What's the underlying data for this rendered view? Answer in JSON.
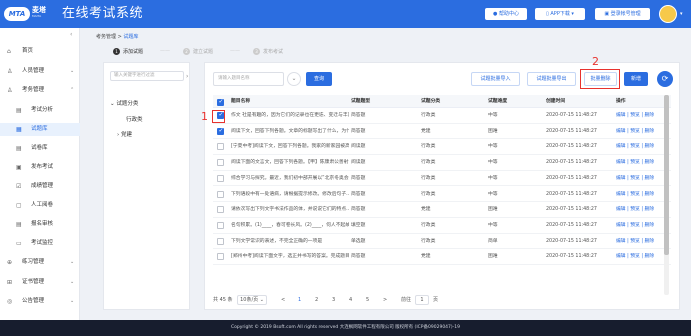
{
  "header": {
    "logo_text": "MTA",
    "brand_name": "麦塔",
    "brand_sub": "MAITA",
    "title": "在线考试系统",
    "help_label": "帮助中心",
    "app_label": "APP下载",
    "user_label": "登录帐号管理"
  },
  "sidebar": {
    "items": [
      {
        "icon": "home-icon",
        "label": "首页"
      },
      {
        "icon": "user-icon",
        "label": "人员管理"
      },
      {
        "icon": "person-icon",
        "label": "考务管理"
      },
      {
        "icon": "chart-icon",
        "label": "考试分析"
      },
      {
        "icon": "question-bank-icon",
        "label": "试题库"
      },
      {
        "icon": "exam-library-icon",
        "label": "试卷库"
      },
      {
        "icon": "publish-icon",
        "label": "发布考试"
      },
      {
        "icon": "score-icon",
        "label": "成绩管理"
      },
      {
        "icon": "grading-icon",
        "label": "人工阅卷"
      },
      {
        "icon": "review-icon",
        "label": "报名审核"
      },
      {
        "icon": "monitor-icon",
        "label": "考试监控"
      },
      {
        "icon": "practice-icon",
        "label": "练习管理"
      },
      {
        "icon": "certificate-icon",
        "label": "证书管理"
      },
      {
        "icon": "notice-icon",
        "label": "公告管理"
      }
    ]
  },
  "breadcrumb": {
    "parent": "考务管理",
    "sep": ">",
    "current": "试题库"
  },
  "steps": [
    {
      "num": "1",
      "label": "添加试题"
    },
    {
      "num": "2",
      "label": "建立试题"
    },
    {
      "num": "3",
      "label": "发布考试"
    }
  ],
  "tree": {
    "search_placeholder": "输入关键字进行过滤",
    "root": "试题分类",
    "child1": "行政类",
    "child2": "党建"
  },
  "toolbar": {
    "search_placeholder": "请输入题目名称",
    "search_btn": "查询",
    "import_btn": "试题批量导入",
    "export_btn": "试题批量导出",
    "delete_btn": "批量删除",
    "add_btn": "新增"
  },
  "table": {
    "headers": [
      "题目名称",
      "试题题型",
      "试题分类",
      "试题难度",
      "创建时间",
      "操作"
    ],
    "rows": [
      {
        "checked": true,
        "name": "作文 社是有趣的，因为它们的记录也在更迭、变迁与丰富...",
        "type": "简答题",
        "category": "行政类",
        "difficulty": "中等",
        "time": "2020-07-15 11:48:27",
        "ops": "编辑 | 预览 | 删除"
      },
      {
        "checked": true,
        "name": "阅读下文，回答下列各题。文章的标题写出了什么，为什么...",
        "type": "简答题",
        "category": "党建",
        "difficulty": "困难",
        "time": "2020-07-15 11:48:27",
        "ops": "编辑 | 预览 | 删除"
      },
      {
        "checked": false,
        "name": "[宁夏中考]阅读下文，回答下列各题。我家的新家园被高楼...",
        "type": "阅读题",
        "category": "行政类",
        "difficulty": "中等",
        "time": "2020-07-15 11:48:27",
        "ops": "编辑 | 预览 | 删除"
      },
      {
        "checked": false,
        "name": "阅读下面的文言文，回答下列各题。【甲】陈康肃公善射...",
        "type": "阅读题",
        "category": "行政类",
        "difficulty": "中等",
        "time": "2020-07-15 11:48:27",
        "ops": "编辑 | 预览 | 删除"
      },
      {
        "checked": false,
        "name": "综合学习与探究。最近，我们初中部开展以“北京冬奥会”...",
        "type": "简答题",
        "category": "行政类",
        "difficulty": "中等",
        "time": "2020-07-15 11:48:27",
        "ops": "编辑 | 预览 | 删除"
      },
      {
        "checked": false,
        "name": "下列语段中有一处语病，请根据提示修改。修改后句子...",
        "type": "简答题",
        "category": "行政类",
        "difficulty": "中等",
        "time": "2020-07-15 11:48:27",
        "ops": "编辑 | 预览 | 删除"
      },
      {
        "checked": false,
        "name": "请依次写出下列文字书法作品的体，并说说它们的特点...",
        "type": "简答题",
        "category": "党建",
        "difficulty": "困难",
        "time": "2020-07-15 11:48:27",
        "ops": "编辑 | 预览 | 删除"
      },
      {
        "checked": false,
        "name": "名句积累。(1)____，春可卷长风。(2)____，何人不起故...",
        "type": "填空题",
        "category": "行政类",
        "difficulty": "中等",
        "time": "2020-07-15 11:48:27",
        "ops": "编辑 | 预览 | 删除"
      },
      {
        "checked": false,
        "name": "下列文学常识的表述，不完全正确的一项是",
        "type": "单选题",
        "category": "行政类",
        "difficulty": "简单",
        "time": "2020-07-15 11:48:27",
        "ops": "编辑 | 预览 | 删除"
      },
      {
        "checked": false,
        "name": "[郑州中考]阅读下面文字，选正并书写的答案。完成题目...",
        "type": "简答题",
        "category": "党建",
        "difficulty": "困难",
        "time": "2020-07-15 11:48:27",
        "ops": "编辑 | 预览 | 删除"
      }
    ]
  },
  "pagination": {
    "total": "共 45 条",
    "page_size": "10条/页",
    "prev": "<",
    "pages": [
      "1",
      "2",
      "3",
      "4",
      "5"
    ],
    "next": ">",
    "goto_label": "前往",
    "goto_value": "1",
    "page_unit": "页"
  },
  "annotations": {
    "marker1": "1",
    "marker2": "2"
  },
  "footer": {
    "text": "Copyright © 2019 Bsoft.com All rights reserved 大连枫网软件工程有限公司 版权所有 (ICP备09029047)-19"
  },
  "colors": {
    "primary": "#2b6de0",
    "annotation": "#e8322e",
    "footer_bg": "#171d2e"
  }
}
